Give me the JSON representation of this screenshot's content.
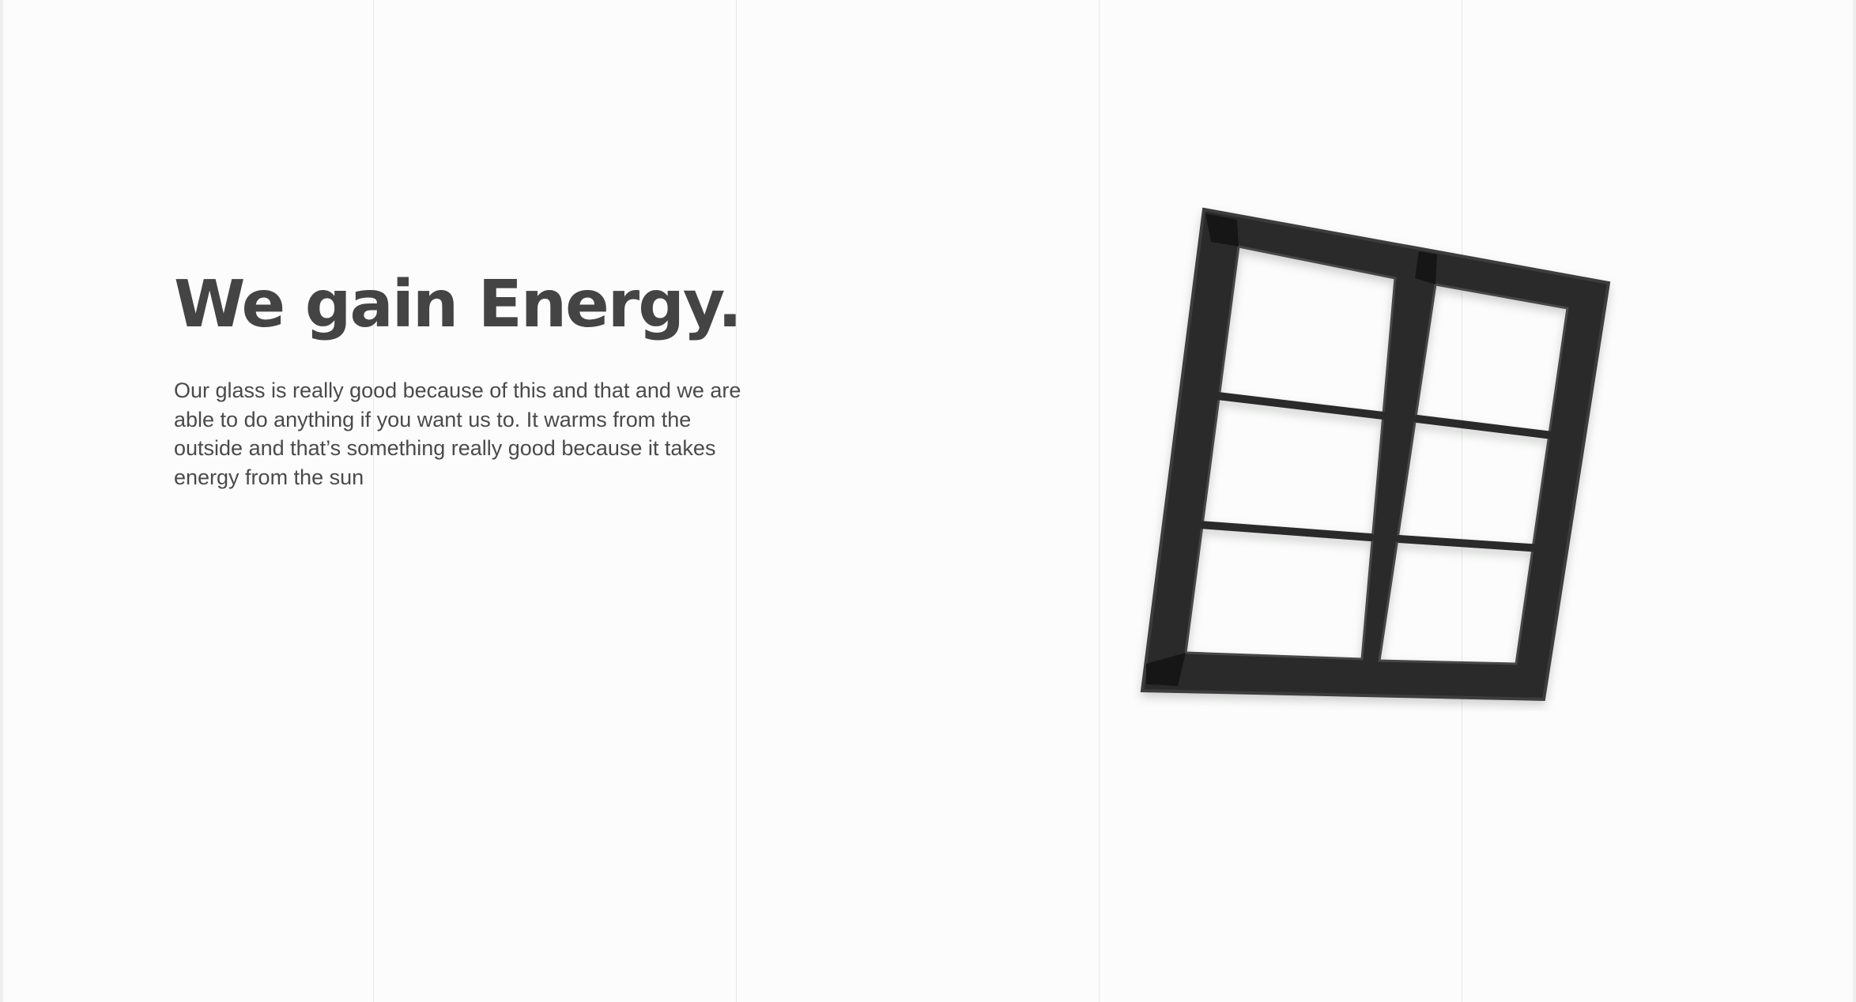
{
  "hero": {
    "title": "We gain Energy.",
    "body": "Our glass is really good because of this and that and we are able to do anything if you want us to. It warms from the outside and that’s something really good because it takes energy from the sun"
  },
  "illustration": {
    "icon": "window-frame-icon",
    "frame_color": "#2c2c2c"
  },
  "colors": {
    "background": "#fbfcfb",
    "text": "#444444",
    "gridline": "#e6e8e6"
  }
}
